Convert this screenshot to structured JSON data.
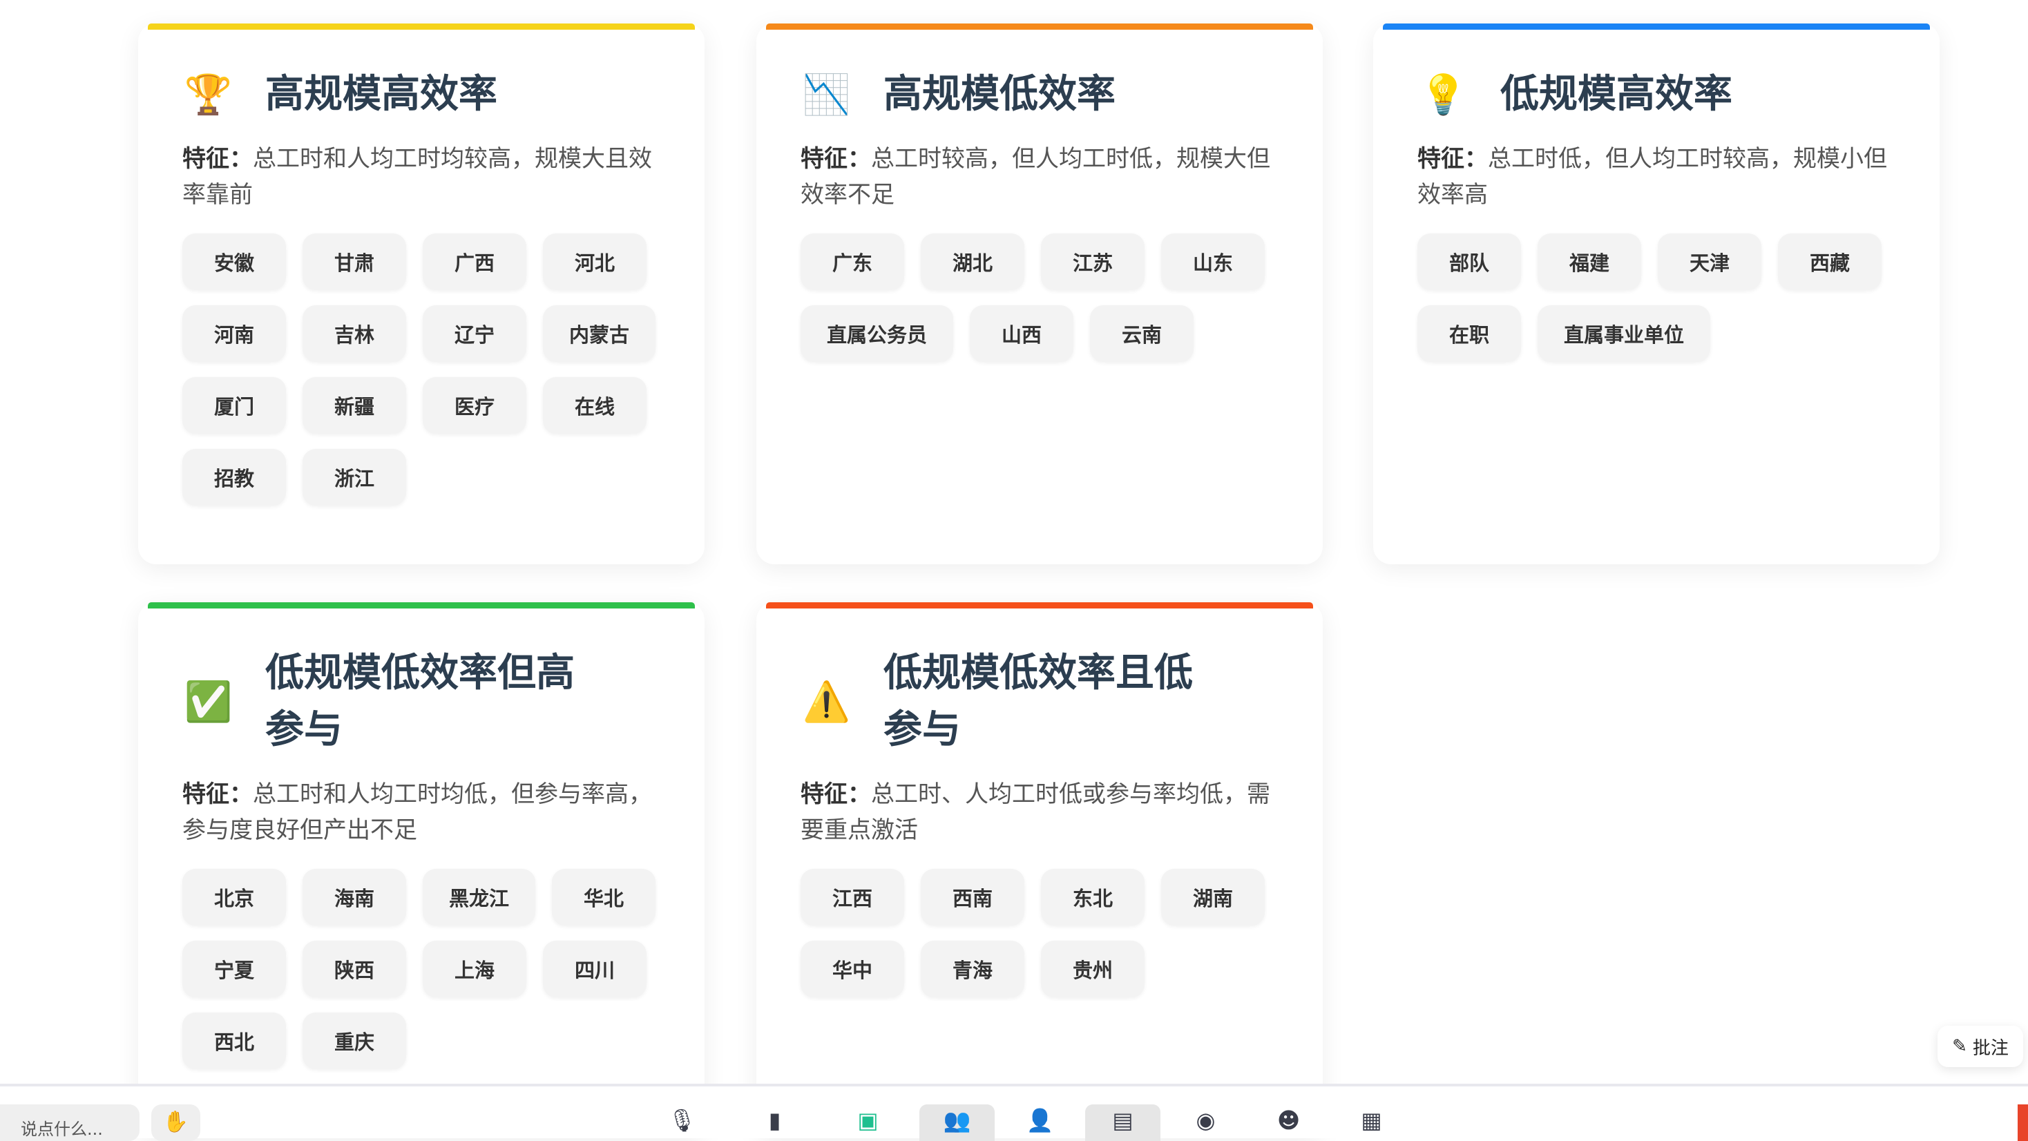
{
  "cards": [
    {
      "title": "高规模高效率",
      "icon": "trophy-icon",
      "color": "#f5d31a",
      "desc_label": "特征：",
      "desc": "总工时和人均工时均较高，规模大且效率靠前",
      "tags": [
        "安徽",
        "甘肃",
        "广西",
        "河北",
        "河南",
        "吉林",
        "辽宁",
        "内蒙古",
        "厦门",
        "新疆",
        "医疗",
        "在线",
        "招教",
        "浙江"
      ]
    },
    {
      "title": "高规模低效率",
      "icon": "chart-down-icon",
      "color": "#f5891a",
      "desc_label": "特征：",
      "desc": "总工时较高，但人均工时低，规模大但效率不足",
      "tags": [
        "广东",
        "湖北",
        "江苏",
        "山东",
        "直属公务员",
        "山西",
        "云南"
      ]
    },
    {
      "title": "低规模高效率",
      "icon": "lightbulb-icon",
      "color": "#1a84f5",
      "desc_label": "特征：",
      "desc": "总工时低，但人均工时较高，规模小但效率高",
      "tags": [
        "部队",
        "福建",
        "天津",
        "西藏",
        "在职",
        "直属事业单位"
      ]
    },
    {
      "title": "低规模低效率但高参与",
      "icon": "check-icon",
      "color": "#2ec04a",
      "desc_label": "特征：",
      "desc": "总工时和人均工时均低，但参与率高，参与度良好但产出不足",
      "tags": [
        "北京",
        "海南",
        "黑龙江",
        "华北",
        "宁夏",
        "陕西",
        "上海",
        "四川",
        "西北",
        "重庆"
      ]
    },
    {
      "title": "低规模低效率且低参与",
      "icon": "warning-icon",
      "color": "#f5501a",
      "desc_label": "特征：",
      "desc": "总工时、人均工时低或参与率均低，需要重点激活",
      "tags": [
        "江西",
        "西南",
        "东北",
        "湖南",
        "华中",
        "青海",
        "贵州"
      ]
    }
  ],
  "toolbar": {
    "chat_placeholder": "说点什么...",
    "annotate_label": "批注"
  }
}
